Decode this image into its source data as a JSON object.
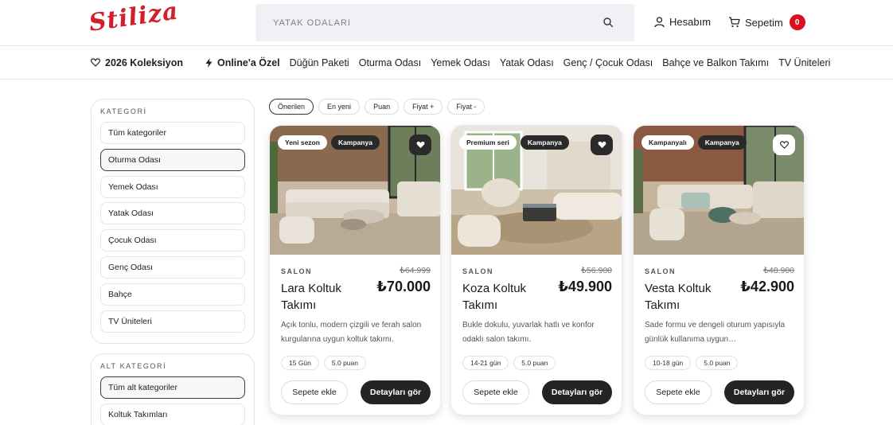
{
  "header": {
    "logo_text": "Stiliza",
    "search_placeholder": "YATAK ODALARI",
    "account_label": "Hesabım",
    "cart_label": "Sepetim",
    "cart_count": "0"
  },
  "nav": {
    "items": [
      "2026 Koleksiyon",
      "Online'a Özel",
      "Düğün Paketi",
      "Oturma Odası",
      "Yemek Odası",
      "Yatak Odası",
      "Genç / Çocuk Odası",
      "Bahçe ve Balkon Takımı",
      "TV Üniteleri"
    ]
  },
  "sidebar": {
    "category_title": "KATEGORİ",
    "categories": [
      "Tüm kategoriler",
      "Oturma Odası",
      "Yemek Odası",
      "Yatak Odası",
      "Çocuk Odası",
      "Genç Odası",
      "Bahçe",
      "TV Üniteleri"
    ],
    "active_category": "Oturma Odası",
    "subcategory_title": "ALT KATEGORİ",
    "subcategories": [
      "Tüm alt kategoriler",
      "Koltuk Takımları"
    ],
    "active_subcategory": "Tüm alt kategoriler"
  },
  "filters": [
    "Önerilen",
    "En yeni",
    "Puan",
    "Fiyat +",
    "Fiyat -"
  ],
  "active_filter": "Önerilen",
  "products": [
    {
      "badges": [
        "Yeni sezon",
        "Kampanya"
      ],
      "favorite_style": "dark",
      "category": "SALON",
      "old_price": "₺64.999",
      "title": "Lara Koltuk Takımı",
      "price": "₺70.000",
      "description": "Açık tonlu, modern çizgili ve ferah salon kurgularına uygun koltuk takımı.",
      "delivery": "15 Gün",
      "rating": "5.0 puan",
      "add_label": "Sepete ekle",
      "details_label": "Detayları gör"
    },
    {
      "badges": [
        "Premium seri",
        "Kampanya"
      ],
      "favorite_style": "dark",
      "category": "SALON",
      "old_price": "₺56.900",
      "title": "Koza Koltuk Takımı",
      "price": "₺49.900",
      "description": "Bukle dokulu, yuvarlak hatlı ve konfor odaklı salon takımı.",
      "delivery": "14-21 gün",
      "rating": "5.0 puan",
      "add_label": "Sepete ekle",
      "details_label": "Detayları gör"
    },
    {
      "badges": [
        "Kampanyalı",
        "Kampanya"
      ],
      "favorite_style": "light",
      "category": "SALON",
      "old_price": "₺48.900",
      "title": "Vesta Koltuk Takımı",
      "price": "₺42.900",
      "description": "Sade formu ve dengeli oturum yapısıyla günlük kullanıma uygun…",
      "delivery": "10-18 gün",
      "rating": "5.0 puan",
      "add_label": "Sepete ekle",
      "details_label": "Detayları gör"
    }
  ],
  "colors": {
    "brand": "#d31f2a",
    "badge_red": "#d8101f",
    "dark_button": "#242424"
  }
}
